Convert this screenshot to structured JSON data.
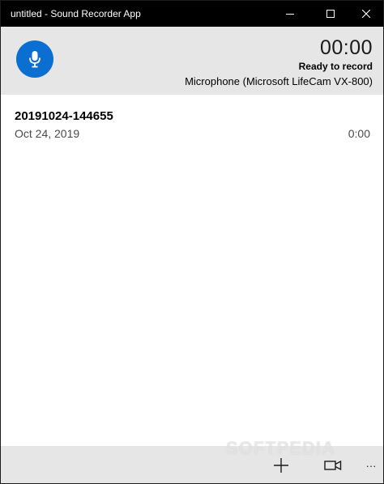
{
  "window": {
    "title": "untitled - Sound Recorder App"
  },
  "header": {
    "timer": "00:00",
    "status": "Ready to record",
    "device": "Microphone (Microsoft LifeCam VX-800)",
    "record_icon": "microphone-icon",
    "accent_color": "#0a6fd0"
  },
  "recordings": [
    {
      "name": "20191024-144655",
      "date": "Oct 24, 2019",
      "duration": "0:00"
    }
  ],
  "commandbar": {
    "icons": [
      "plus-icon",
      "video-camera-icon",
      "more-icon"
    ],
    "more_label": "···"
  },
  "watermark": "SOFTPEDIA"
}
